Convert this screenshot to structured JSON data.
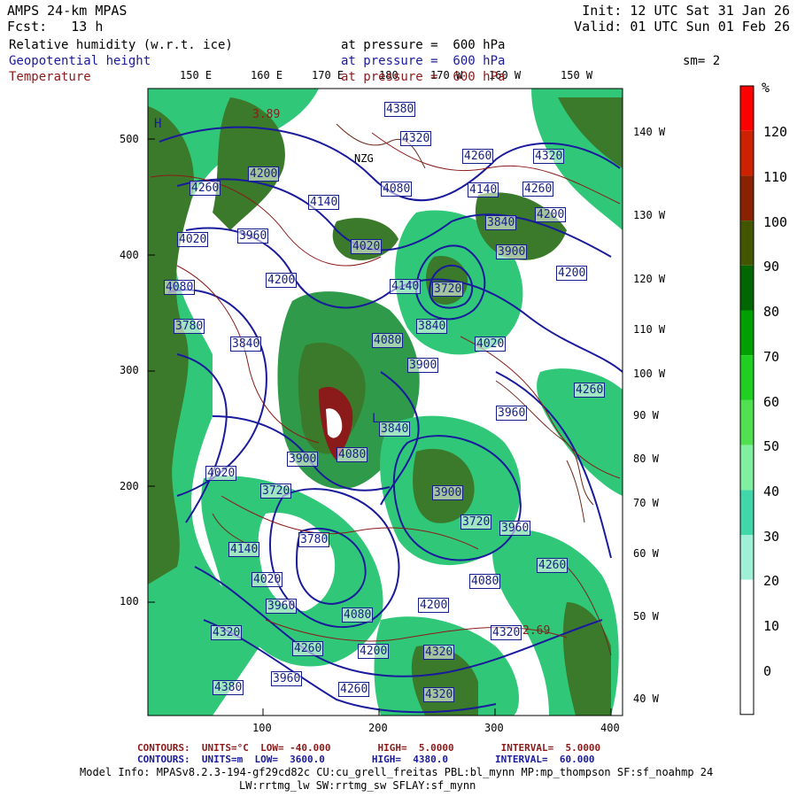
{
  "header": {
    "model": "AMPS 24-km MPAS",
    "init": "Init: 12 UTC Sat 31 Jan 26",
    "fcst": "Fcst:   13 h",
    "valid": "Valid: 01 UTC Sun 01 Feb 26"
  },
  "fields": [
    {
      "name": "Relative humidity (w.r.t. ice)",
      "level": "at pressure =  600 hPa",
      "color": "#000000"
    },
    {
      "name": "Geopotential height",
      "level": "at pressure =  600 hPa",
      "color": "#1a1a9c"
    },
    {
      "name": "Temperature",
      "level": "at pressure =  600 hPa",
      "color": "#8b1a1a"
    }
  ],
  "smoothing": "sm= 2",
  "colorbar": {
    "unit": "%",
    "labels": [
      "120",
      "110",
      "100",
      "90",
      "80",
      "70",
      "60",
      "50",
      "40",
      "30",
      "20",
      "10",
      "0"
    ],
    "colors": [
      "#ff0000",
      "#cc2200",
      "#882200",
      "#445500",
      "#006600",
      "#00a000",
      "#20d020",
      "#50e050",
      "#80f0a0",
      "#40d8a8",
      "#a0f0d8",
      "#ffffff",
      "#ffffff",
      "#ffffff"
    ]
  },
  "axes": {
    "y_ticks": [
      "500",
      "400",
      "300",
      "200",
      "100"
    ],
    "x_ticks": [
      "100",
      "200",
      "300",
      "400"
    ],
    "lon_top": [
      "150 E",
      "160 E",
      "170 E",
      "180",
      "170 W",
      "160 W",
      "150 W"
    ],
    "lon_right": [
      "140 W",
      "130 W",
      "120 W",
      "110 W",
      "100 W",
      "90 W",
      "80 W",
      "70 W",
      "60 W",
      "50 W",
      "40 W"
    ]
  },
  "contour_labels": [
    "4380",
    "4320",
    "4260",
    "4320",
    "4200",
    "4260",
    "4140",
    "4080",
    "4140",
    "4260",
    "4200",
    "4020",
    "3960",
    "3840",
    "4020",
    "3900",
    "4200",
    "4080",
    "4200",
    "4140",
    "3720",
    "3840",
    "3780",
    "3840",
    "4020",
    "4080",
    "4260",
    "3900",
    "3960",
    "3720",
    "4020",
    "3900",
    "3840",
    "4080",
    "3720",
    "3780",
    "4260",
    "3960",
    "4140",
    "4020",
    "4080",
    "4320",
    "4200",
    "4080",
    "4320",
    "3960",
    "4260",
    "4200",
    "4320",
    "4380",
    "4260",
    "3960",
    "3900",
    "4320"
  ],
  "temp_labels": [
    "3.89",
    "2.69"
  ],
  "station_labels": [
    "NZG"
  ],
  "markers": [
    "H",
    "L"
  ],
  "footer": {
    "temp_contours": "CONTOURS:  UNITS=°C  LOW= -40.000        HIGH=  5.0000        INTERVAL=  5.0000",
    "height_contours": "CONTOURS:  UNITS=m  LOW=  3600.0        HIGH=  4380.0        INTERVAL=  60.000",
    "model_info": "Model Info: MPASv8.2.3-194-gf29cd82c CU:cu_grell_freitas PBL:bl_mynn MP:mp_thompson SF:sf_noahmp 24",
    "model_info2": "LW:rrtmg_lw SW:rrtmg_sw SFLAY:sf_mynn",
    "temp_color": "#8b1a1a",
    "height_color": "#1a1a9c"
  }
}
